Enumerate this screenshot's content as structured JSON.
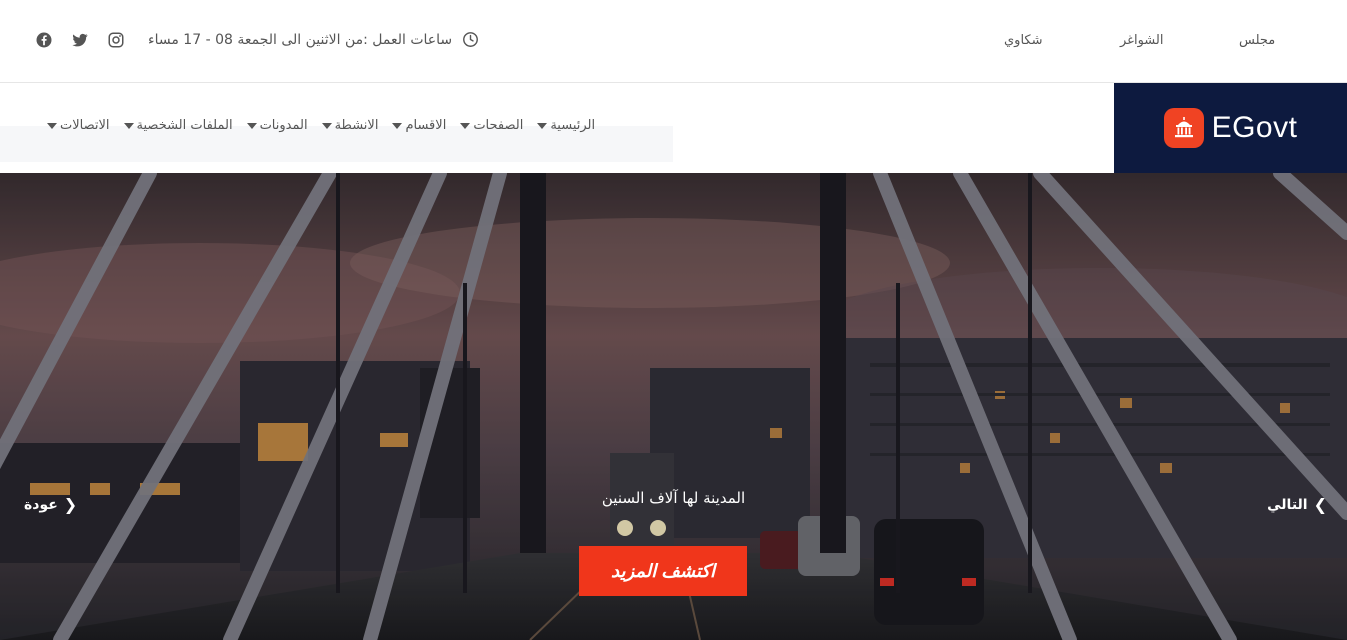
{
  "topbar": {
    "social_icons": [
      "facebook-icon",
      "twitter-icon",
      "instagram-icon"
    ],
    "hours_text": "ساعات العمل :من الاثنين الى الجمعة 08 - 17 مساء",
    "links": [
      "مجلس",
      "الشواغر",
      "شكاوي"
    ]
  },
  "nav": {
    "items": [
      "الرئيسية",
      "الصفحات",
      "الاقسام",
      "الانشطة",
      "المدونات",
      "الملفات الشخصية",
      "الاتصالات"
    ]
  },
  "brand": {
    "name": "EGovt",
    "logo_icon": "capitol-building-icon",
    "bg_color": "#0d1a3f",
    "accent_color": "#f04323"
  },
  "hero": {
    "caption": "المدينة لها آلاف السنين",
    "cta_label": "اكتشف المزيد",
    "prev_label": "عودة",
    "next_label": "التالي",
    "cta_color": "#f0361b"
  }
}
